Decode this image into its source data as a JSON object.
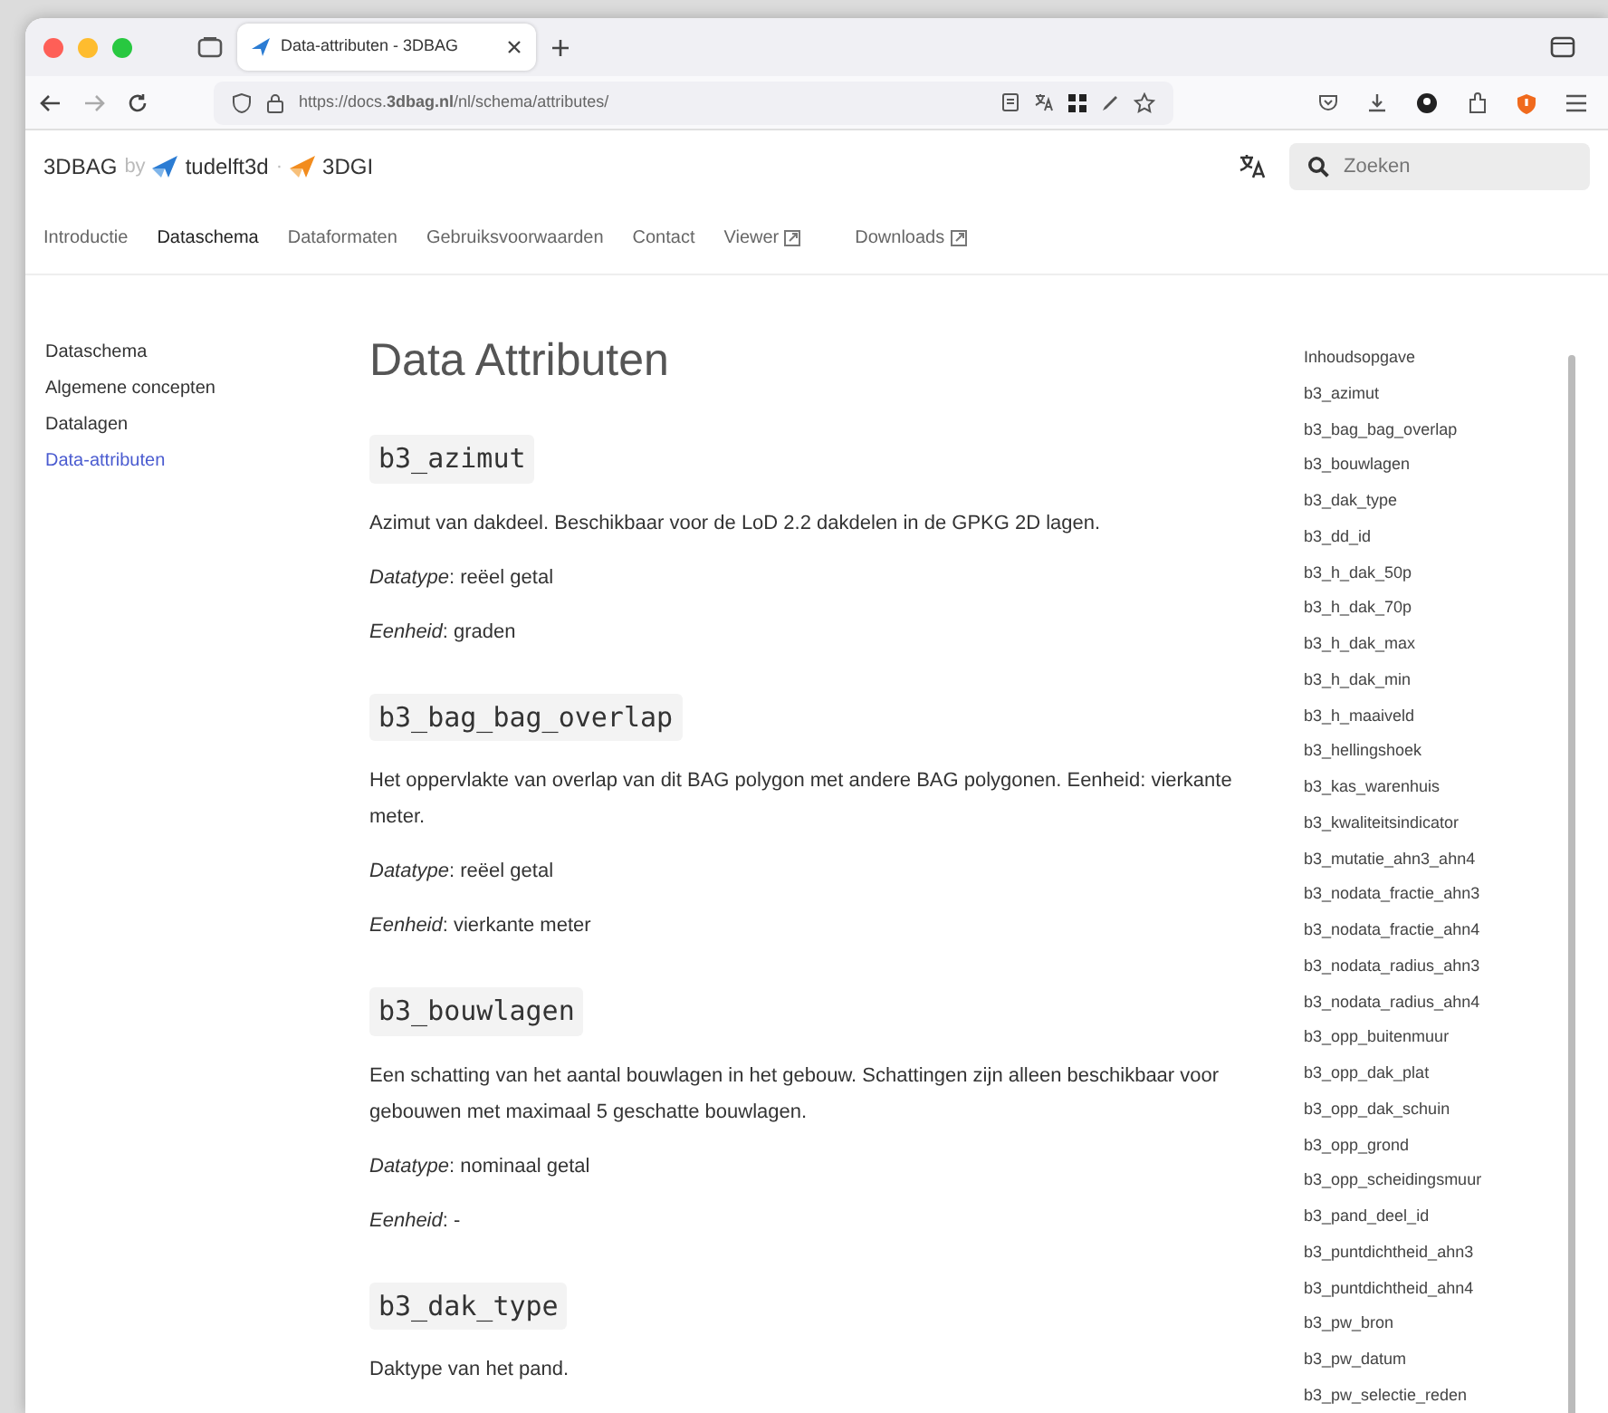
{
  "browser": {
    "tab_title": "Data-attributen - 3DBAG",
    "url": "https://docs.**3dbag.nl**/nl/schema/attributes/"
  },
  "header": {
    "logo": "3DBAG",
    "by": "by",
    "partner_1": "tudelft3d",
    "separator": "·",
    "partner_2": "3DGI",
    "search": {
      "placeholder": "Zoeken"
    }
  },
  "nav": [
    {
      "label": "Introductie",
      "selected": false,
      "external": false
    },
    {
      "label": "Dataschema",
      "selected": true,
      "external": false
    },
    {
      "label": "Dataformaten",
      "selected": false,
      "external": false
    },
    {
      "label": "Gebruiksvoorwaarden",
      "selected": false,
      "external": false
    },
    {
      "label": "Contact",
      "selected": false,
      "external": false
    },
    {
      "label": "Viewer",
      "selected": false,
      "external": true
    },
    {
      "label": "Downloads",
      "selected": false,
      "external": true
    }
  ],
  "sidebar": [
    {
      "label": "Dataschema",
      "selected": false
    },
    {
      "label": "Algemene concepten",
      "selected": false
    },
    {
      "label": "Datalagen",
      "selected": false
    },
    {
      "label": "Data-attributen",
      "selected": true
    }
  ],
  "page_title": "Data Attributen",
  "attributes": [
    {
      "name": "b3_azimut",
      "description": "Azimut van dakdeel. Beschikbaar voor de LoD 2.2 dakdelen in de GPKG 2D lagen.",
      "details": [
        "*Datatype*: reëel getal",
        "*Eenheid*: graden"
      ]
    },
    {
      "name": "b3_bag_bag_overlap",
      "description": "Het oppervlakte van overlap van dit BAG polygon met andere BAG polygonen. Eenheid: vierkante meter.",
      "details": [
        "*Datatype*: reëel getal",
        "*Eenheid*: vierkante meter"
      ]
    },
    {
      "name": "b3_bouwlagen",
      "description": "Een schatting van het aantal bouwlagen in het gebouw. Schattingen zijn alleen beschikbaar voor gebouwen met maximaal 5 geschatte bouwlagen.",
      "details": [
        "*Datatype*: nominaal getal",
        "*Eenheid*: -"
      ]
    },
    {
      "name": "b3_dak_type",
      "description": "Daktype van het pand."
    }
  ],
  "toc": {
    "title": "Inhoudsopgave",
    "items": [
      "b3_azimut",
      "b3_bag_bag_overlap",
      "b3_bouwlagen",
      "b3_dak_type",
      "b3_dd_id",
      "b3_h_dak_50p",
      "b3_h_dak_70p",
      "b3_h_dak_max",
      "b3_h_dak_min",
      "b3_h_maaiveld",
      "b3_hellingshoek",
      "b3_kas_warenhuis",
      "b3_kwaliteitsindicator",
      "b3_mutatie_ahn3_ahn4",
      "b3_nodata_fractie_ahn3",
      "b3_nodata_fractie_ahn4",
      "b3_nodata_radius_ahn3",
      "b3_nodata_radius_ahn4",
      "b3_opp_buitenmuur",
      "b3_opp_dak_plat",
      "b3_opp_dak_schuin",
      "b3_opp_grond",
      "b3_opp_scheidingsmuur",
      "b3_pand_deel_id",
      "b3_puntdichtheid_ahn3",
      "b3_puntdichtheid_ahn4",
      "b3_pw_bron",
      "b3_pw_datum",
      "b3_pw_selectie_reden"
    ]
  }
}
